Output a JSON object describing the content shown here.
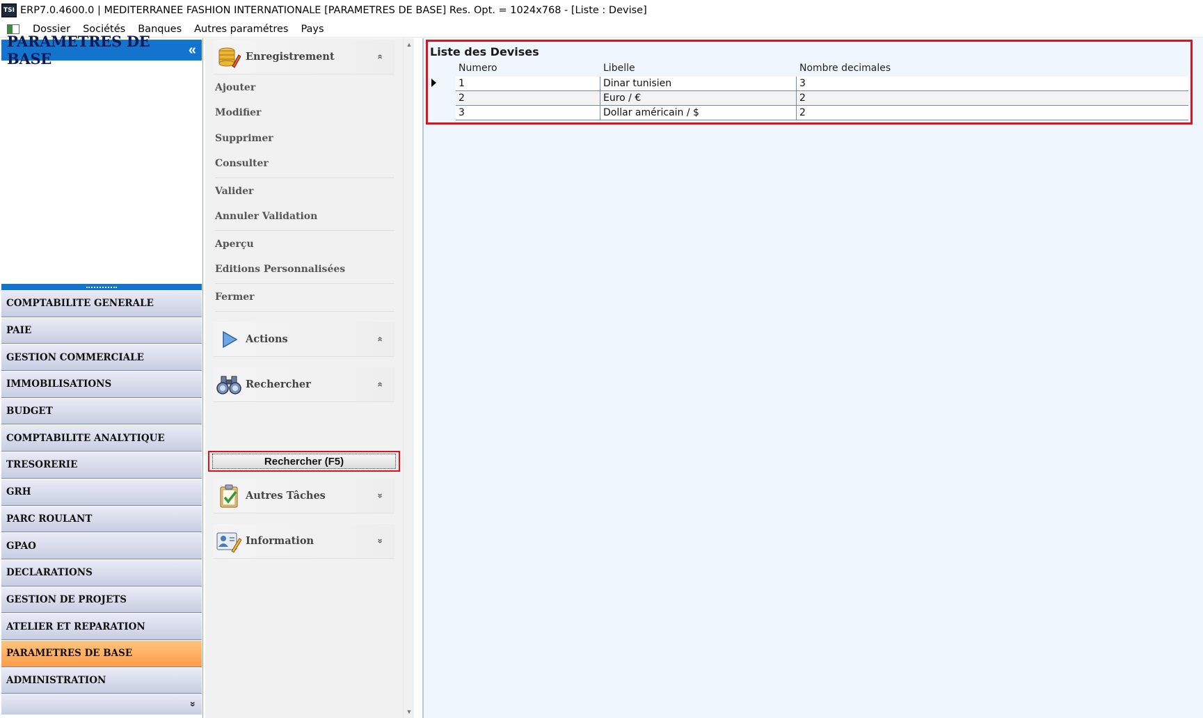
{
  "window": {
    "logo_text": "TSI",
    "title": "ERP7.0.4600.0 | MEDITERRANEE FASHION INTERNATIONALE [PARAMETRES DE BASE] Res. Opt. = 1024x768 - [Liste : Devise]"
  },
  "menu": {
    "items": [
      "Dossier",
      "Sociétés",
      "Banques",
      "Autres paramétres",
      "Pays"
    ]
  },
  "nav": {
    "header": "PARAMETRES DE BASE",
    "collapse_glyph": "«",
    "items": [
      {
        "label": "COMPTABILITE GENERALE"
      },
      {
        "label": "PAIE"
      },
      {
        "label": "GESTION COMMERCIALE"
      },
      {
        "label": "IMMOBILISATIONS"
      },
      {
        "label": "BUDGET"
      },
      {
        "label": "COMPTABILITE ANALYTIQUE"
      },
      {
        "label": "TRESORERIE"
      },
      {
        "label": "GRH"
      },
      {
        "label": "PARC ROULANT"
      },
      {
        "label": "GPAO"
      },
      {
        "label": "DECLARATIONS"
      },
      {
        "label": "GESTION DE PROJETS"
      },
      {
        "label": "ATELIER ET REPARATION"
      },
      {
        "label": "PARAMETRES DE BASE",
        "active": true
      },
      {
        "label": "ADMINISTRATION"
      }
    ],
    "footer_glyph": "»",
    "active_color": "#ff9d4a"
  },
  "tasks": {
    "enregistrement": {
      "title": "Enregistrement",
      "chevron": "«",
      "items": {
        "ajouter": "Ajouter",
        "modifier": "Modifier",
        "supprimer": "Supprimer",
        "consulter": "Consulter",
        "valider": "Valider",
        "annuler": "Annuler Validation",
        "apercu": "Aperçu",
        "editions": "Editions Personnalisées",
        "fermer": "Fermer"
      }
    },
    "actions": {
      "title": "Actions",
      "chevron": "«"
    },
    "rechercher": {
      "title": "Rechercher",
      "chevron": "«",
      "button": "Rechercher (F5)"
    },
    "autres": {
      "title": "Autres Tâches",
      "chevron": "»"
    },
    "information": {
      "title": "Information",
      "chevron": "»"
    }
  },
  "grid": {
    "title": "Liste des Devises",
    "columns": [
      "Numero",
      "Libelle",
      "Nombre decimales"
    ],
    "rows": [
      [
        "1",
        "Dinar tunisien",
        "3"
      ],
      [
        "2",
        "Euro / €",
        "2"
      ],
      [
        "3",
        "Dollar américain / $",
        "2"
      ]
    ]
  },
  "colors": {
    "nav_header": "#1274cc",
    "highlight_border": "#d8141e",
    "content_bg": "#f0f6fe"
  }
}
